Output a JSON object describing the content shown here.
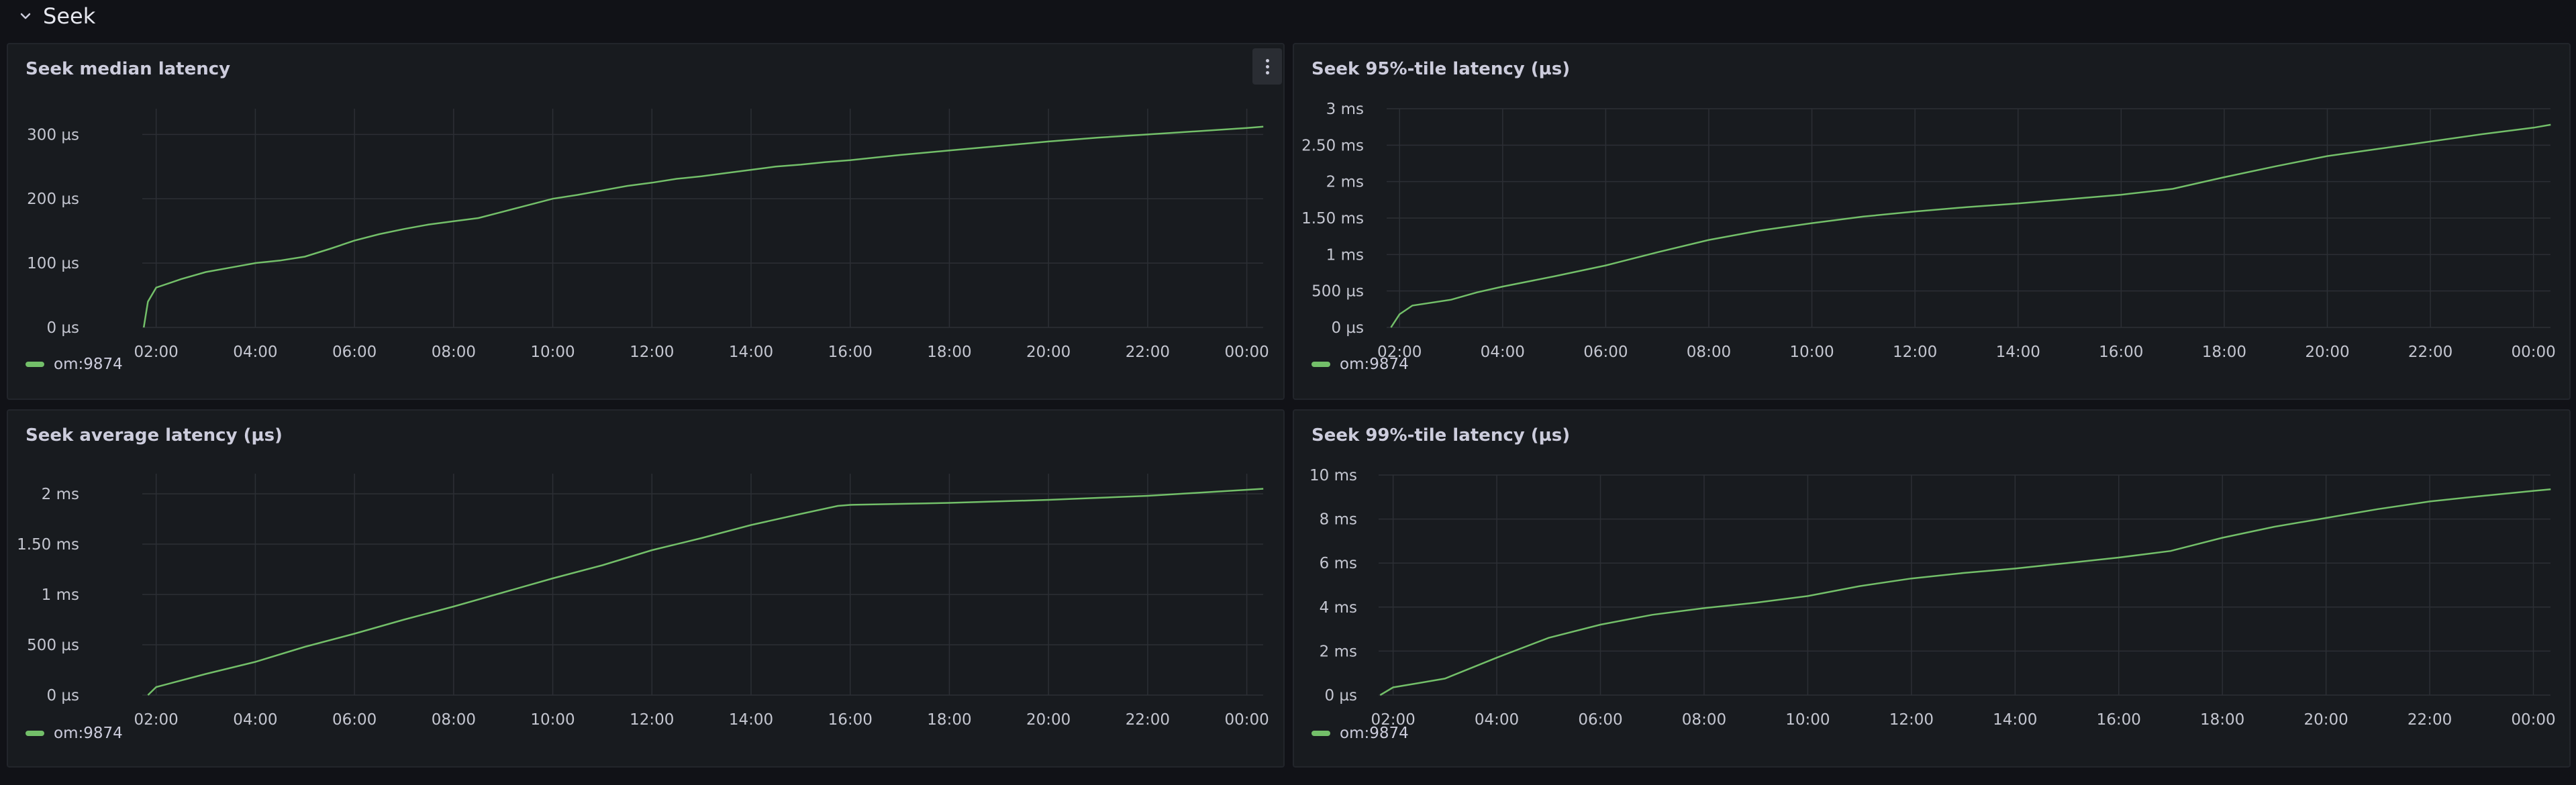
{
  "row": {
    "title": "Seek",
    "collapse_icon": "chevron-down-icon"
  },
  "panels": [
    {
      "title": "Seek median latency",
      "has_menu": true,
      "legend": "om:9874",
      "chart_data": {
        "type": "line",
        "x_ticks": [
          "02:00",
          "04:00",
          "06:00",
          "08:00",
          "10:00",
          "12:00",
          "14:00",
          "16:00",
          "18:00",
          "20:00",
          "22:00",
          "00:00"
        ],
        "y_ticks": [
          "300 µs",
          "200 µs",
          "100 µs",
          "0 µs"
        ],
        "y_tick_values": [
          300,
          200,
          100,
          0
        ],
        "unit": "µs",
        "ylim": [
          0,
          340
        ],
        "grid": true,
        "legend_position": "bottom-left",
        "series": [
          {
            "name": "om:9874",
            "color": "#73bf69",
            "x": [
              "01:45",
              "01:50",
              "02:00",
              "02:30",
              "03:00",
              "03:30",
              "04:00",
              "04:30",
              "05:00",
              "05:30",
              "06:00",
              "06:30",
              "07:00",
              "07:30",
              "08:00",
              "08:30",
              "09:00",
              "09:30",
              "10:00",
              "10:30",
              "11:00",
              "11:30",
              "12:00",
              "12:30",
              "13:00",
              "13:30",
              "14:00",
              "14:30",
              "15:00",
              "15:30",
              "16:00",
              "17:00",
              "18:00",
              "19:00",
              "20:00",
              "21:00",
              "22:00",
              "23:00",
              "00:00",
              "00:20"
            ],
            "y": [
              0,
              40,
              62,
              75,
              86,
              93,
              100,
              104,
              110,
              122,
              135,
              145,
              153,
              160,
              165,
              170,
              180,
              190,
              200,
              206,
              213,
              220,
              225,
              231,
              235,
              240,
              245,
              250,
              253,
              257,
              260,
              268,
              275,
              282,
              289,
              295,
              300,
              305,
              310,
              312
            ]
          }
        ]
      }
    },
    {
      "title": "Seek 95%-tile latency (µs)",
      "has_menu": false,
      "legend": "om:9874",
      "chart_data": {
        "type": "line",
        "x_ticks": [
          "02:00",
          "04:00",
          "06:00",
          "08:00",
          "10:00",
          "12:00",
          "14:00",
          "16:00",
          "18:00",
          "20:00",
          "22:00",
          "00:00"
        ],
        "y_ticks": [
          "3 ms",
          "2.50 ms",
          "2 ms",
          "1.50 ms",
          "1 ms",
          "500 µs",
          "0 µs"
        ],
        "y_tick_values": [
          3000,
          2500,
          2000,
          1500,
          1000,
          500,
          0
        ],
        "unit": "µs",
        "ylim": [
          0,
          3000
        ],
        "grid": true,
        "legend_position": "bottom-left",
        "series": [
          {
            "name": "om:9874",
            "color": "#73bf69",
            "x": [
              "01:50",
              "02:00",
              "02:15",
              "03:00",
              "03:30",
              "04:00",
              "05:00",
              "06:00",
              "07:00",
              "08:00",
              "09:00",
              "10:00",
              "11:00",
              "12:00",
              "13:00",
              "14:00",
              "15:00",
              "16:00",
              "17:00",
              "18:00",
              "19:00",
              "20:00",
              "21:00",
              "22:00",
              "23:00",
              "00:00",
              "00:20"
            ],
            "y": [
              0,
              180,
              300,
              380,
              480,
              560,
              700,
              850,
              1030,
              1200,
              1330,
              1430,
              1520,
              1590,
              1650,
              1700,
              1760,
              1820,
              1900,
              2060,
              2210,
              2350,
              2450,
              2550,
              2650,
              2740,
              2780
            ]
          }
        ]
      }
    },
    {
      "title": "Seek average latency (µs)",
      "has_menu": false,
      "legend": "om:9874",
      "chart_data": {
        "type": "line",
        "x_ticks": [
          "02:00",
          "04:00",
          "06:00",
          "08:00",
          "10:00",
          "12:00",
          "14:00",
          "16:00",
          "18:00",
          "20:00",
          "22:00",
          "00:00"
        ],
        "y_ticks": [
          "2 ms",
          "1.50 ms",
          "1 ms",
          "500 µs",
          "0 µs"
        ],
        "y_tick_values": [
          2000,
          1500,
          1000,
          500,
          0
        ],
        "unit": "µs",
        "ylim": [
          0,
          2200
        ],
        "grid": true,
        "legend_position": "bottom-left",
        "series": [
          {
            "name": "om:9874",
            "color": "#73bf69",
            "x": [
              "01:50",
              "02:00",
              "03:00",
              "04:00",
              "05:00",
              "06:00",
              "07:00",
              "08:00",
              "09:00",
              "10:00",
              "11:00",
              "12:00",
              "13:00",
              "14:00",
              "15:00",
              "15:45",
              "16:00",
              "17:00",
              "18:00",
              "19:00",
              "20:00",
              "21:00",
              "22:00",
              "23:00",
              "00:00",
              "00:20"
            ],
            "y": [
              0,
              80,
              210,
              330,
              480,
              610,
              750,
              880,
              1020,
              1160,
              1290,
              1440,
              1560,
              1690,
              1800,
              1880,
              1890,
              1900,
              1910,
              1925,
              1940,
              1960,
              1980,
              2010,
              2040,
              2050
            ]
          }
        ]
      }
    },
    {
      "title": "Seek 99%-tile latency (µs)",
      "has_menu": false,
      "legend": "om:9874",
      "chart_data": {
        "type": "line",
        "x_ticks": [
          "02:00",
          "04:00",
          "06:00",
          "08:00",
          "10:00",
          "12:00",
          "14:00",
          "16:00",
          "18:00",
          "20:00",
          "22:00",
          "00:00"
        ],
        "y_ticks": [
          "10 ms",
          "8 ms",
          "6 ms",
          "4 ms",
          "2 ms",
          "0 µs"
        ],
        "y_tick_values": [
          10000,
          8000,
          6000,
          4000,
          2000,
          0
        ],
        "unit": "µs",
        "ylim": [
          0,
          10000
        ],
        "grid": true,
        "legend_position": "bottom-left",
        "series": [
          {
            "name": "om:9874",
            "color": "#73bf69",
            "x": [
              "01:45",
              "02:00",
              "02:30",
              "03:00",
              "04:00",
              "05:00",
              "06:00",
              "07:00",
              "08:00",
              "09:00",
              "10:00",
              "11:00",
              "12:00",
              "13:00",
              "14:00",
              "15:00",
              "16:00",
              "17:00",
              "18:00",
              "19:00",
              "20:00",
              "21:00",
              "22:00",
              "23:00",
              "00:00",
              "00:20"
            ],
            "y": [
              0,
              350,
              550,
              750,
              1700,
              2600,
              3200,
              3650,
              3950,
              4200,
              4500,
              4950,
              5300,
              5550,
              5750,
              6000,
              6250,
              6550,
              7150,
              7650,
              8050,
              8450,
              8800,
              9050,
              9280,
              9350
            ]
          }
        ]
      }
    }
  ]
}
